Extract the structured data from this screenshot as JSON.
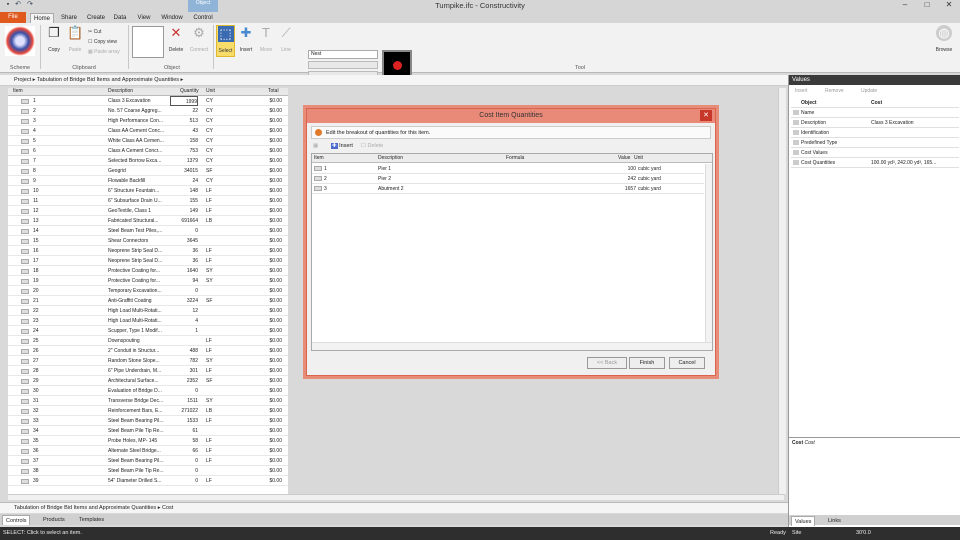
{
  "app": {
    "title": "Tumpike.ifc - Constructivity",
    "ctx_tab": "Object"
  },
  "tabs": [
    "File",
    "Home",
    "Share",
    "Create",
    "Data",
    "View",
    "Window",
    "Control"
  ],
  "ribbon": {
    "paste_small": {
      "cut": "Cut",
      "copy_view": "Copy view",
      "paste_array": "Paste array"
    },
    "copy": "Copy",
    "paste": "Paste",
    "delete": "Delete",
    "connect": "Connect",
    "select": "Select",
    "insert": "Insert",
    "move": "Move",
    "line": "Line",
    "groups": {
      "scheme": "Scheme",
      "clipboard": "Clipboard",
      "object": "Object",
      "tool": "Tool"
    },
    "nest_value": "Nest",
    "browse": "Browse"
  },
  "breadcrumb": {
    "root": "Project",
    "path": "Tabulation of Bridge Bid Items and Approximate Quantities"
  },
  "grid": {
    "columns": [
      "Item",
      "Description",
      "Quantity",
      "Unit",
      "Total"
    ],
    "rows": [
      [
        "1",
        "Class 3 Excavation",
        "1999",
        "CY",
        "$0.00"
      ],
      [
        "2",
        "No. 57 Coarse Aggreg...",
        "22",
        "CY",
        "$0.00"
      ],
      [
        "3",
        "High Performance Con...",
        "513",
        "CY",
        "$0.00"
      ],
      [
        "4",
        "Class AA Cement Conc...",
        "43",
        "CY",
        "$0.00"
      ],
      [
        "5",
        "White Class AA Cemen...",
        "158",
        "CY",
        "$0.00"
      ],
      [
        "6",
        "Class A Cement Concr...",
        "753",
        "CY",
        "$0.00"
      ],
      [
        "7",
        "Selected Borrow Exca...",
        "1379",
        "CY",
        "$0.00"
      ],
      [
        "8",
        "Geogrid",
        "34015",
        "SF",
        "$0.00"
      ],
      [
        "9",
        "Flowable Backfill",
        "24",
        "CY",
        "$0.00"
      ],
      [
        "10",
        "6\" Structure Fountain...",
        "148",
        "LF",
        "$0.00"
      ],
      [
        "11",
        "6\" Subsurface Drain U...",
        "155",
        "LF",
        "$0.00"
      ],
      [
        "12",
        "GeoTextile, Class 1",
        "149",
        "LF",
        "$0.00"
      ],
      [
        "13",
        "Fabricated Structural...",
        "691664",
        "LB",
        "$0.00"
      ],
      [
        "14",
        "Steel Beam Test Piles,...",
        "0",
        "",
        "$0.00"
      ],
      [
        "15",
        "Shear Connectors",
        "3645",
        "",
        "$0.00"
      ],
      [
        "16",
        "Neoprene Strip Seal D...",
        "36",
        "LF",
        "$0.00"
      ],
      [
        "17",
        "Neoprene Strip Seal D...",
        "36",
        "LF",
        "$0.00"
      ],
      [
        "18",
        "Protective Coating for...",
        "1640",
        "SY",
        "$0.00"
      ],
      [
        "19",
        "Protective Coating for...",
        "94",
        "SY",
        "$0.00"
      ],
      [
        "20",
        "Temporary Excavation...",
        "0",
        "",
        "$0.00"
      ],
      [
        "21",
        "Anti-Graffiti Coating",
        "3224",
        "SF",
        "$0.00"
      ],
      [
        "22",
        "High Load Multi-Rotati...",
        "12",
        "",
        "$0.00"
      ],
      [
        "23",
        "High Load Multi-Rotati...",
        "4",
        "",
        "$0.00"
      ],
      [
        "24",
        "Scupper, Type 1 Modif...",
        "1",
        "",
        "$0.00"
      ],
      [
        "25",
        "Downspouting",
        "",
        "LF",
        "$0.00"
      ],
      [
        "26",
        "2\" Conduit in Structur...",
        "488",
        "LF",
        "$0.00"
      ],
      [
        "27",
        "Random Stone Slope...",
        "782",
        "SY",
        "$0.00"
      ],
      [
        "28",
        "6\" Pipe Underdrain, M...",
        "301",
        "LF",
        "$0.00"
      ],
      [
        "29",
        "Architectural Surface...",
        "2352",
        "SF",
        "$0.00"
      ],
      [
        "30",
        "Evaluation of Bridge D...",
        "0",
        "",
        "$0.00"
      ],
      [
        "31",
        "Transverse Bridge Dec...",
        "1511",
        "SY",
        "$0.00"
      ],
      [
        "32",
        "Reinforcement Bars, E...",
        "271022",
        "LB",
        "$0.00"
      ],
      [
        "33",
        "Steel Beam Bearing Pil...",
        "1533",
        "LF",
        "$0.00"
      ],
      [
        "34",
        "Steel Beam Pile Tip Re...",
        "61",
        "",
        "$0.00"
      ],
      [
        "35",
        "Probe Holes, MP- 145",
        "58",
        "LF",
        "$0.00"
      ],
      [
        "36",
        "Alternate Steel Bridge...",
        "66",
        "LF",
        "$0.00"
      ],
      [
        "37",
        "Steel Beam Bearing Pil...",
        "0",
        "LF",
        "$0.00"
      ],
      [
        "38",
        "Steel Beam Pile Tip Re...",
        "0",
        "",
        "$0.00"
      ],
      [
        "39",
        "54\" Diameter Drilled S...",
        "0",
        "LF",
        "$0.00"
      ]
    ]
  },
  "bottom": {
    "path": "Tabulation of Bridge Bid Items and Approximate Quantities",
    "leaf": "Cost",
    "tabs": [
      "Controls",
      "Products",
      "Templates"
    ]
  },
  "status": {
    "left": "SELECT: Click to select an item.",
    "ready": "Ready",
    "site": "Site",
    "zoom": "30'0.0"
  },
  "values_panel": {
    "title": "Values",
    "tools": [
      "Insert",
      "Remove",
      "Update"
    ],
    "header": [
      "Object",
      "Cost"
    ],
    "props": [
      [
        "Name",
        ""
      ],
      [
        "Description",
        "Class 3 Excavation"
      ],
      [
        "Identification",
        ""
      ],
      [
        "Predefined Type",
        ""
      ],
      [
        "Cost Values",
        ""
      ],
      [
        "Cost Quantities",
        "100.00 yd³, 242.00 yd³, 165..."
      ]
    ],
    "desc_title": "Cost",
    "desc_sub": "Cost",
    "tabs": [
      "Values",
      "Links"
    ]
  },
  "dialog": {
    "title": "Cost Item Quantities",
    "info": "Edit the breakout of quantities for this item.",
    "insert": "Insert",
    "delete": "Delete",
    "columns": [
      "Item",
      "Description",
      "Formula",
      "Value",
      "Unit"
    ],
    "rows": [
      [
        "1",
        "Pier 1",
        "",
        "100",
        "cubic yard"
      ],
      [
        "2",
        "Pier 2",
        "",
        "242",
        "cubic yard"
      ],
      [
        "3",
        "Abutment 2",
        "",
        "1657",
        "cubic yard"
      ]
    ],
    "back": "<< Back",
    "finish": "Finish",
    "cancel": "Cancel"
  },
  "colors": {
    "file_tab": "#e05a1e",
    "dialog_title": "#e98a79",
    "close_btn": "#c8382a",
    "select_highlight": "#f8dc6a"
  }
}
